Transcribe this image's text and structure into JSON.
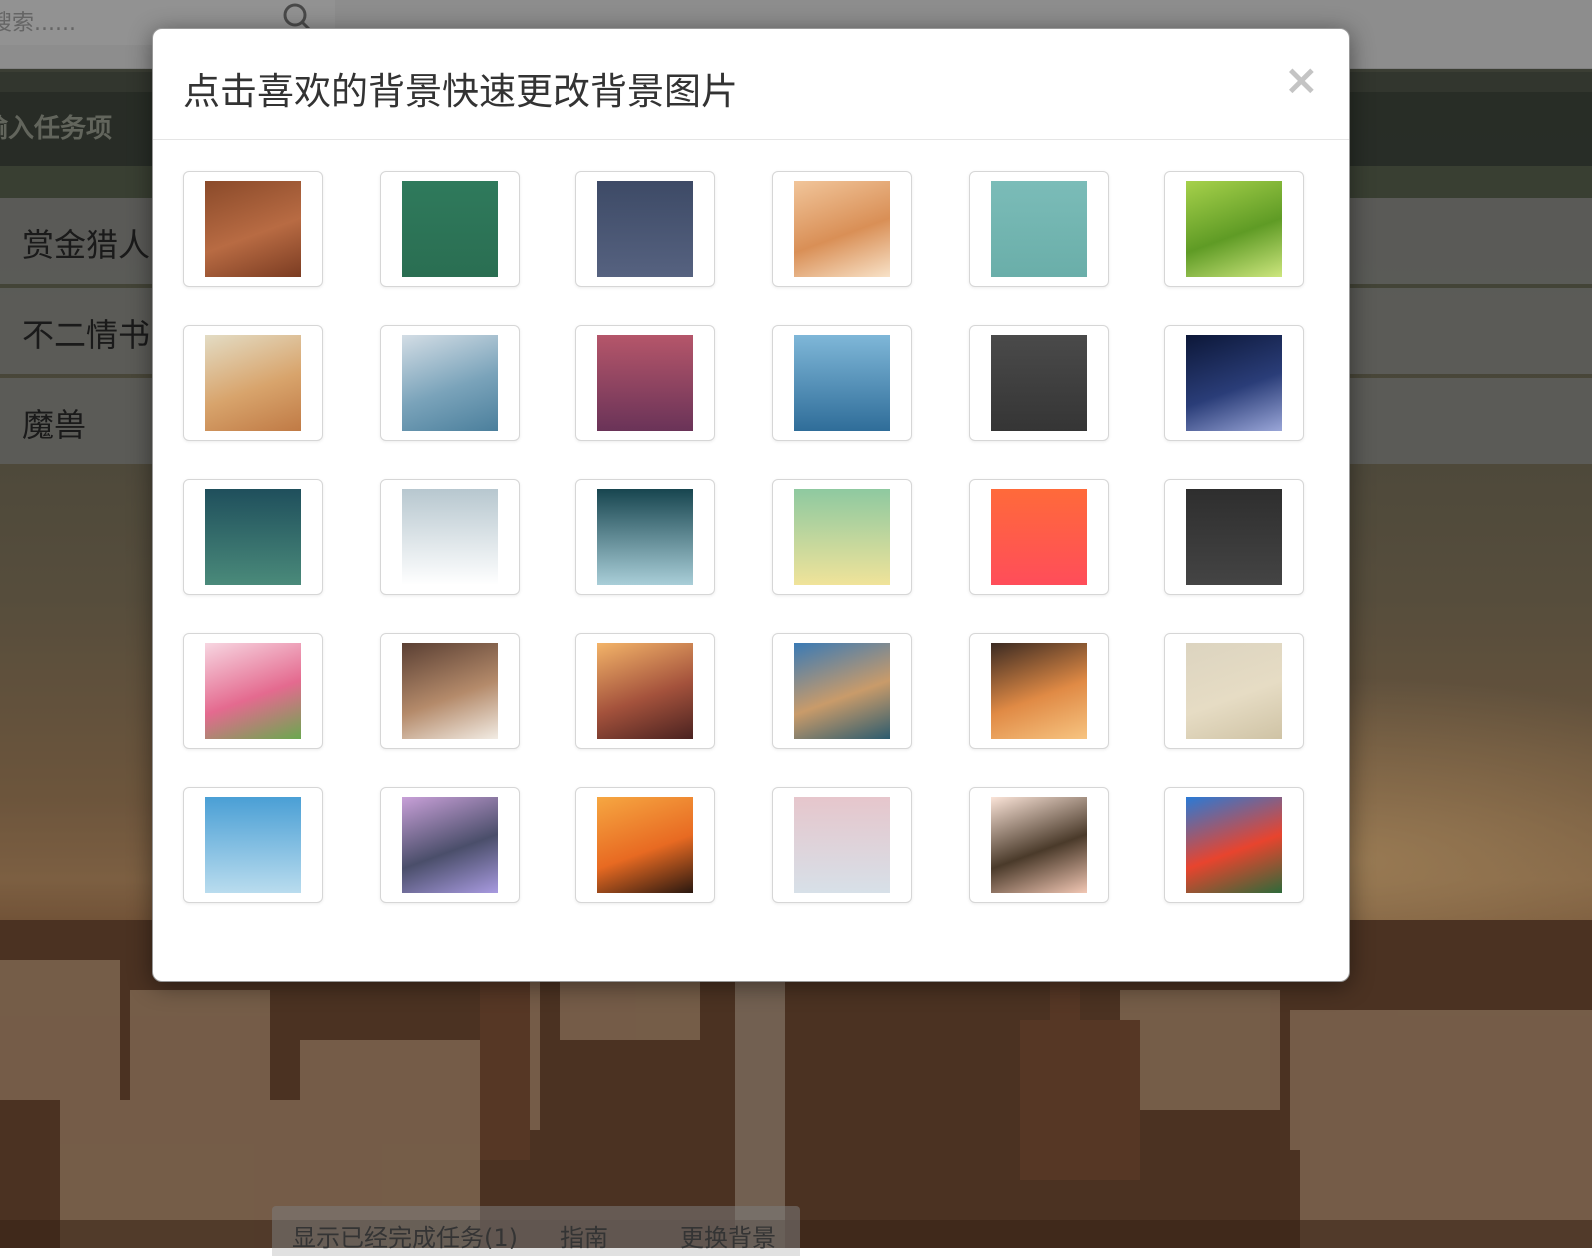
{
  "search": {
    "placeholder": "搜索......"
  },
  "task_input": {
    "placeholder": "输入任务项"
  },
  "tasks": [
    {
      "label": "赏金猎人"
    },
    {
      "label": "不二情书"
    },
    {
      "label": "魔兽"
    }
  ],
  "bottom": {
    "show_done": "显示已经完成任务(1)",
    "guide": "指南",
    "change_bg": "更换背景"
  },
  "modal": {
    "title": "点击喜欢的背景快速更改背景图片",
    "close": "×"
  },
  "backgrounds": [
    {
      "name": "wood-brown",
      "colors": [
        "#8a4a2a",
        "#b86b43",
        "#7b3c22"
      ]
    },
    {
      "name": "green-chalk",
      "colors": [
        "#2f7a5c",
        "#2a6e52"
      ]
    },
    {
      "name": "slate-blue",
      "colors": [
        "#3d4a66",
        "#566280"
      ]
    },
    {
      "name": "sleeping-cat",
      "colors": [
        "#f1c59a",
        "#d98f56",
        "#f8e2c8"
      ]
    },
    {
      "name": "teal-cartoon",
      "colors": [
        "#7bbcb8",
        "#6aaea9"
      ]
    },
    {
      "name": "green-grass",
      "colors": [
        "#a6d14b",
        "#5f9b25",
        "#cde67e"
      ]
    },
    {
      "name": "tv-tower",
      "colors": [
        "#e3dcc4",
        "#d8a46c",
        "#c07a45"
      ]
    },
    {
      "name": "blue-haze",
      "colors": [
        "#d3dde5",
        "#7aa3ba",
        "#4b7f9c"
      ]
    },
    {
      "name": "rose-purple",
      "colors": [
        "#b5566a",
        "#6a3358"
      ]
    },
    {
      "name": "rain-drops",
      "colors": [
        "#7fb7d8",
        "#2f6d99"
      ]
    },
    {
      "name": "dark-wood",
      "colors": [
        "#4a4a4a",
        "#353535"
      ]
    },
    {
      "name": "night-gradient",
      "colors": [
        "#0c1738",
        "#2a3d78",
        "#9aa6d8"
      ]
    },
    {
      "name": "teal-green",
      "colors": [
        "#1f4f5c",
        "#4a8a7a"
      ]
    },
    {
      "name": "fog-white",
      "colors": [
        "#b7c7cf",
        "#ffffff"
      ]
    },
    {
      "name": "ocean-teal",
      "colors": [
        "#17454f",
        "#a9ced8"
      ]
    },
    {
      "name": "mint-yellow",
      "colors": [
        "#8ec9a0",
        "#f0e39a"
      ]
    },
    {
      "name": "orange-red",
      "colors": [
        "#ff6a3a",
        "#ff4d5a"
      ]
    },
    {
      "name": "charcoal",
      "colors": [
        "#2e2e2e",
        "#444444"
      ]
    },
    {
      "name": "pink-tulips",
      "colors": [
        "#f7d6e1",
        "#e46a8f",
        "#6aa84f"
      ]
    },
    {
      "name": "sleeping-dog",
      "colors": [
        "#5a3f33",
        "#b48a6a",
        "#f2ece4"
      ]
    },
    {
      "name": "sunset-city",
      "colors": [
        "#f3b469",
        "#a4523c",
        "#4a2220"
      ]
    },
    {
      "name": "venice-canal",
      "colors": [
        "#3a7ab5",
        "#c99b6a",
        "#2c5b6e"
      ]
    },
    {
      "name": "city-street",
      "colors": [
        "#3b2a22",
        "#e08a45",
        "#f7c481"
      ]
    },
    {
      "name": "sand-beach",
      "colors": [
        "#dcd4c0",
        "#e6dcc4",
        "#cfc3a5"
      ]
    },
    {
      "name": "sky-sea",
      "colors": [
        "#4a9fd5",
        "#b9dcee"
      ]
    },
    {
      "name": "purple-buildings",
      "colors": [
        "#c8a0d8",
        "#4a4e6a",
        "#a89ae0"
      ]
    },
    {
      "name": "temple-sunset",
      "colors": [
        "#f6a742",
        "#e86a22",
        "#2a1810"
      ]
    },
    {
      "name": "frosty-plant",
      "colors": [
        "#e6c6cc",
        "#d7e0e8"
      ]
    },
    {
      "name": "cherry-blossom",
      "colors": [
        "#fbe4d8",
        "#4a3a2a",
        "#f2c7b4"
      ]
    },
    {
      "name": "hot-air-balloons",
      "colors": [
        "#2a7ad6",
        "#e8442e",
        "#2e6a3a"
      ]
    }
  ]
}
